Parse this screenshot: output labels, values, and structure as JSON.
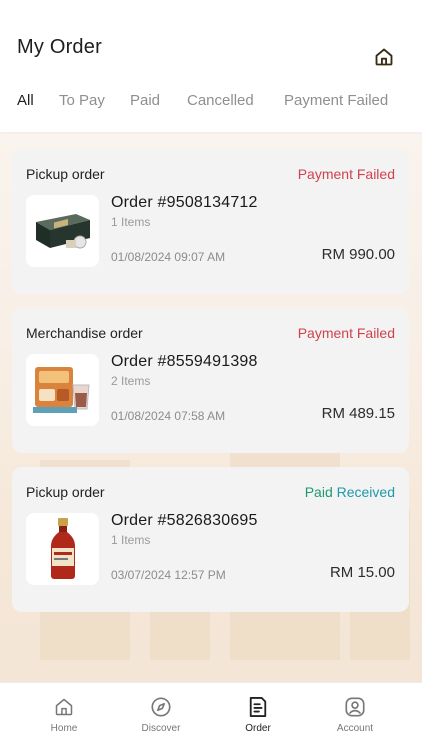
{
  "header": {
    "title": "My Order",
    "home_icon": "home-icon"
  },
  "tabs": [
    {
      "label": "All",
      "active": true
    },
    {
      "label": "To Pay",
      "active": false
    },
    {
      "label": "Paid",
      "active": false
    },
    {
      "label": "Cancelled",
      "active": false
    },
    {
      "label": "Payment Failed",
      "active": false
    }
  ],
  "orders": [
    {
      "type": "Pickup order",
      "status": "Payment Failed",
      "order_no": "Order #9508134712",
      "items": "1 Items",
      "date": "01/08/2024 09:07 AM",
      "price": "RM 990.00",
      "thumb": "gift-box-product-image"
    },
    {
      "type": "Merchandise order",
      "status": "Payment Failed",
      "order_no": "Order #8559491398",
      "items": "2 Items",
      "date": "01/08/2024 07:58 AM",
      "price": "RM 489.15",
      "thumb": "drink-pack-product-image"
    },
    {
      "type": "Pickup order",
      "status_part1": "Paid ",
      "status_part2": "Received",
      "order_no": "Order #5826830695",
      "items": "1 Items",
      "date": "03/07/2024 12:57 PM",
      "price": "RM 15.00",
      "thumb": "sauce-bottle-product-image"
    }
  ],
  "bottom_nav": [
    {
      "label": "Home",
      "icon": "home-icon",
      "active": false
    },
    {
      "label": "Discover",
      "icon": "compass-icon",
      "active": false
    },
    {
      "label": "Order",
      "icon": "receipt-icon",
      "active": true
    },
    {
      "label": "Account",
      "icon": "user-icon",
      "active": false
    }
  ],
  "colors": {
    "failed": "#d0434c",
    "paid": "#1c9a6e",
    "received": "#1b9aa8",
    "accent_icon": "#3a2a10"
  }
}
